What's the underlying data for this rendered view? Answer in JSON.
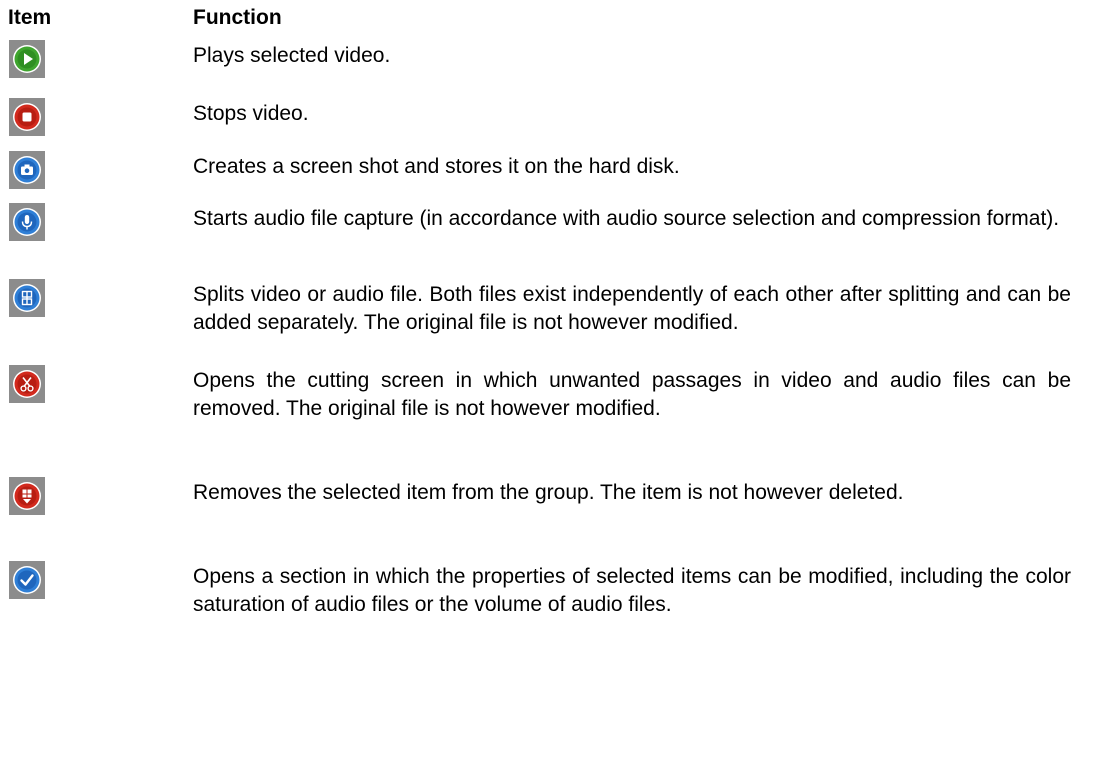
{
  "header": {
    "item_label": "Item",
    "function_label": "Function"
  },
  "rows": [
    {
      "icon": "play-icon",
      "color": "#3fa52e",
      "description": "Plays selected video."
    },
    {
      "icon": "stop-icon",
      "color": "#d22a1e",
      "description": "Stops video."
    },
    {
      "icon": "camera-icon",
      "color": "#2f7fd6",
      "description": "Creates a screen shot and stores it on the hard disk."
    },
    {
      "icon": "microphone-icon",
      "color": "#2f7fd6",
      "description": "Starts audio file capture (in accordance with audio source selection and compression format)."
    },
    {
      "icon": "split-icon",
      "color": "#2f7fd6",
      "description": "Splits video or audio file. Both files exist independently of each other after splitting and can be added separately. The original file is not however modified."
    },
    {
      "icon": "scissors-icon",
      "color": "#d22a1e",
      "description": "Opens the cutting screen in which unwanted passages in video and audio files can be removed. The original file is not however modified."
    },
    {
      "icon": "remove-icon",
      "color": "#d22a1e",
      "description": "Removes the selected item from the group. The item is not however deleted."
    },
    {
      "icon": "checkmark-icon",
      "color": "#2f7fd6",
      "description": "Opens a section in which the properties of selected items can be modified, including the color saturation of audio files or the volume of audio files."
    }
  ]
}
